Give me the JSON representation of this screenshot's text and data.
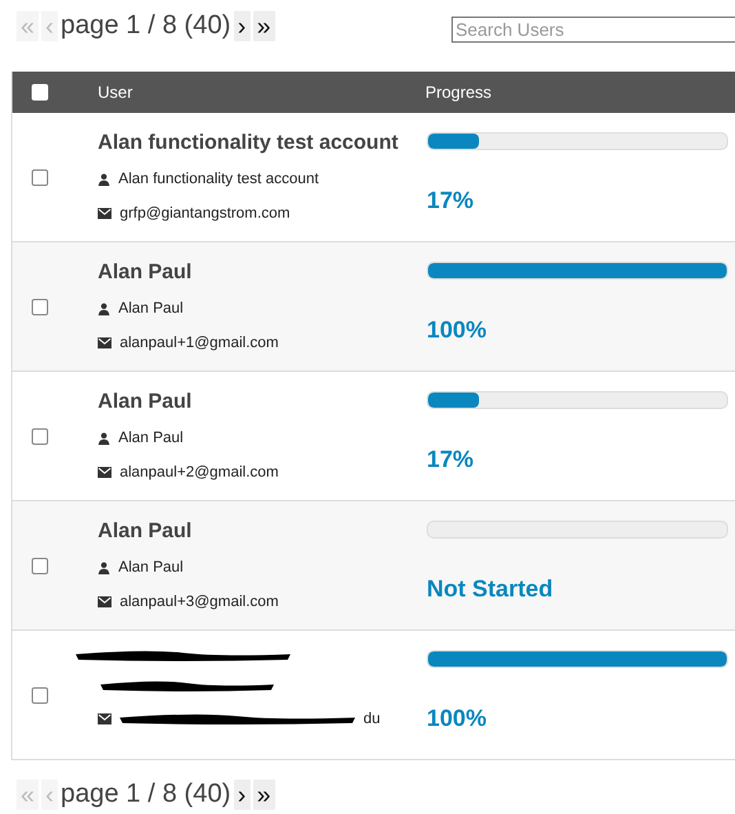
{
  "pager_top": {
    "first": {
      "label": "«",
      "disabled": true
    },
    "prev": {
      "label": "‹",
      "disabled": true
    },
    "text": "page 1 / 8 (40)",
    "next": {
      "label": "›",
      "disabled": false
    },
    "last": {
      "label": "»",
      "disabled": false
    }
  },
  "search": {
    "placeholder": "Search Users"
  },
  "table": {
    "select_all": {
      "checked": false
    },
    "columns": [
      "User",
      "Progress"
    ],
    "rows": [
      {
        "kind": "account",
        "checked": false,
        "name": "Alan functionality test account",
        "username": "Alan functionality test account",
        "email": "grfp@giantangstrom.com",
        "level": 0.17,
        "reading": "17%"
      },
      {
        "kind": "account",
        "checked": false,
        "name": "Alan Paul",
        "username": "Alan Paul",
        "email": "alanpaul+1@gmail.com",
        "level": 1,
        "reading": "100%"
      },
      {
        "kind": "account",
        "checked": false,
        "name": "Alan Paul",
        "username": "Alan Paul",
        "email": "alanpaul+2@gmail.com",
        "level": 0.17,
        "reading": "17%"
      },
      {
        "kind": "account",
        "checked": false,
        "name": "Alan Paul",
        "username": "Alan Paul",
        "email": "alanpaul+3@gmail.com",
        "level": 0,
        "reading": "Not Started"
      },
      {
        "kind": "redacted",
        "checked": false,
        "email_tail": "du",
        "level": 1,
        "reading": "100%"
      }
    ]
  },
  "pager_bottom": {
    "first": {
      "label": "«",
      "disabled": true
    },
    "prev": {
      "label": "‹",
      "disabled": true
    },
    "text": "page 1 / 8 (40)",
    "next": {
      "label": "›",
      "disabled": false
    },
    "last": {
      "label": "»",
      "disabled": false
    }
  }
}
